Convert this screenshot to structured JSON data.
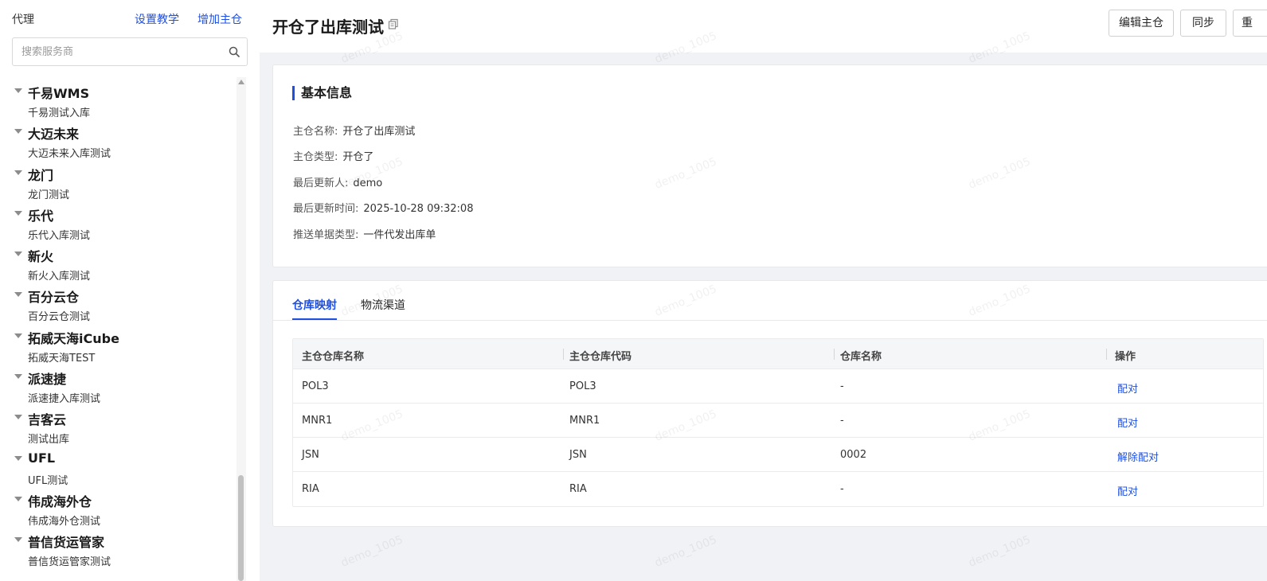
{
  "sidebar": {
    "title": "代理",
    "link_setup_tutorial": "设置教学",
    "link_add_main_warehouse": "增加主仓",
    "search_placeholder": "搜索服务商",
    "groups": [
      {
        "label": "千易WMS",
        "child": "千易测试入库"
      },
      {
        "label": "大迈未来",
        "child": "大迈未来入库测试"
      },
      {
        "label": "龙门",
        "child": "龙门测试"
      },
      {
        "label": "乐代",
        "child": "乐代入库测试"
      },
      {
        "label": "新火",
        "child": "新火入库测试"
      },
      {
        "label": "百分云仓",
        "child": "百分云仓测试"
      },
      {
        "label": "拓威天海iCube",
        "child": "拓威天海TEST"
      },
      {
        "label": "派速捷",
        "child": "派速捷入库测试"
      },
      {
        "label": "吉客云",
        "child": "测试出库"
      },
      {
        "label": "UFL",
        "child": "UFL测试"
      },
      {
        "label": "伟成海外仓",
        "child": "伟成海外仓测试"
      },
      {
        "label": "普信货运管家",
        "child": "普信货运管家测试"
      }
    ]
  },
  "header": {
    "title": "开仓了出库测试",
    "buttons": {
      "edit": "编辑主仓",
      "sync": "同步",
      "more": "重"
    }
  },
  "info": {
    "section_title": "基本信息",
    "fields": [
      {
        "key": "主仓名称:",
        "value": "开仓了出库测试"
      },
      {
        "key": "主仓类型:",
        "value": "开仓了"
      },
      {
        "key": "最后更新人:",
        "value": "demo"
      },
      {
        "key": "最后更新时间:",
        "value": "2025-10-28 09:32:08"
      },
      {
        "key": "推送单据类型:",
        "value": "一件代发出库单"
      }
    ]
  },
  "tabs": {
    "items": [
      "仓库映射",
      "物流渠道"
    ],
    "active": "仓库映射"
  },
  "table": {
    "columns": [
      "主仓仓库名称",
      "主仓仓库代码",
      "仓库名称",
      "操作"
    ],
    "rows": [
      {
        "name": "POL3",
        "code": "POL3",
        "warehouse": "-",
        "action": "配对"
      },
      {
        "name": "MNR1",
        "code": "MNR1",
        "warehouse": "-",
        "action": "配对"
      },
      {
        "name": "JSN",
        "code": "JSN",
        "warehouse": "0002",
        "action": "解除配对"
      },
      {
        "name": "RIA",
        "code": "RIA",
        "warehouse": "-",
        "action": "配对"
      }
    ]
  },
  "watermark": "demo_1005",
  "colors": {
    "accent": "#1f4fe0",
    "background": "#f0f2f5"
  }
}
